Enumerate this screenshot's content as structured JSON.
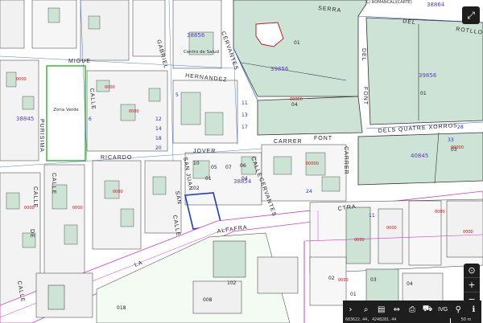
{
  "map": {
    "top_label": "C/ ROMANCALI(CARTE)",
    "streets": {
      "serra": "SERRA",
      "del": "DEL",
      "rotllo": "ROTLLO",
      "font_vertical": "FONT",
      "del_vertical": "DEL",
      "dels_quatre_xorros": "DELS   QUATRE   XORROS",
      "carrer": "CARRER",
      "font": "FONT",
      "carrer_vertical": "CARRER",
      "hernandez": "HERNANDEZ",
      "cervantes_top": "CERVANTES",
      "gabriel": "GABRIEL",
      "miguel": "MIGUE",
      "jover": "JOVER",
      "ricardo": "RICARDO",
      "calle_vertical": "CALLE",
      "cervantes_bottom": "CERVANTES",
      "ctra": "CTRA",
      "alfafra": "ALFAFRA",
      "la": "LA",
      "calle_left": "CALLE",
      "purisima": "PURISIMA",
      "calle_main": "CALLE",
      "san_juan": "SAN JUAN",
      "calle_mid": "CALLE",
      "san": "SAN",
      "calle_low": "CALLE",
      "de": "DE",
      "calle_bottom": "CALLE"
    },
    "zones": {
      "zona_verde": "Zona Verde",
      "centro_salud": "Centro de Salud"
    },
    "refs": [
      "39856",
      "39856",
      "38856",
      "40845",
      "38864",
      "38845",
      "38854"
    ],
    "parcels": [
      "01",
      "04",
      "01",
      "03",
      "01",
      "02",
      "04",
      "07",
      "05",
      "06",
      "008",
      "018",
      "102",
      "02",
      "01",
      "03",
      "04",
      "10"
    ],
    "streets_numbers": [
      "11",
      "13",
      "17",
      "5",
      "6",
      "12",
      "14",
      "18",
      "20",
      "28",
      "33",
      "24",
      "11"
    ]
  },
  "controls": {
    "expand_icon": "⤢",
    "zoom_target_icon": "⊙",
    "zoom_in": "+",
    "zoom_out": "−"
  },
  "toolbar": {
    "arrow_icon": "›",
    "search_icon": "⌕",
    "layers_icon": "▤",
    "measure_icon": "⇔",
    "print_icon": "⎙",
    "street_icon": "⛟",
    "ivg_label": "IVG",
    "route_icon": "⚲",
    "info_icon": "ℹ"
  },
  "status": {
    "coords": "683622.44, 4248281.44",
    "scale": "50 m"
  }
}
